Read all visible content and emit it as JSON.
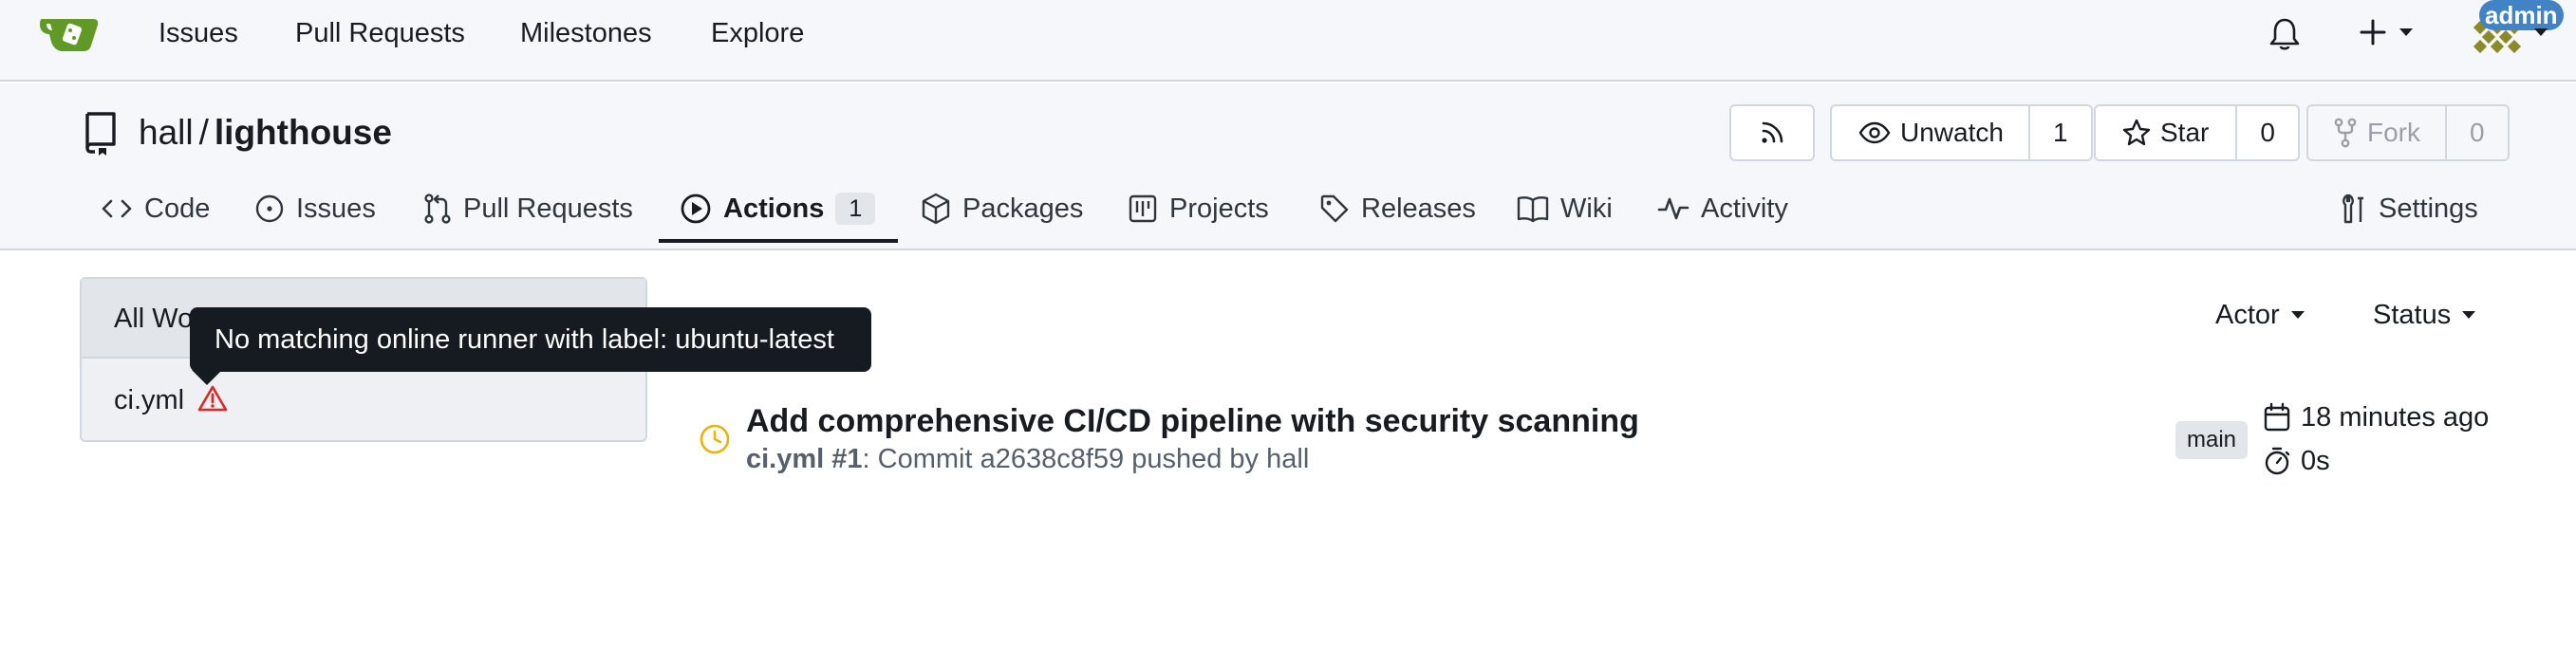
{
  "navbar": {
    "links": [
      "Issues",
      "Pull Requests",
      "Milestones",
      "Explore"
    ],
    "admin_badge": "admin"
  },
  "repo": {
    "owner": "hall",
    "separator": "/",
    "name": "lighthouse",
    "unwatch_label": "Unwatch",
    "watch_count": "1",
    "star_label": "Star",
    "star_count": "0",
    "fork_label": "Fork",
    "fork_count": "0"
  },
  "tabs": {
    "code": "Code",
    "issues": "Issues",
    "pull_requests": "Pull Requests",
    "actions": "Actions",
    "actions_count": "1",
    "packages": "Packages",
    "projects": "Projects",
    "releases": "Releases",
    "wiki": "Wiki",
    "activity": "Activity",
    "settings": "Settings"
  },
  "sidebar": {
    "items": [
      {
        "label": "All Workflows"
      },
      {
        "label": "ci.yml"
      }
    ]
  },
  "tooltip": {
    "text": "No matching online runner with label: ubuntu-latest"
  },
  "filters": {
    "actor": "Actor",
    "status": "Status"
  },
  "run": {
    "title": "Add comprehensive CI/CD pipeline with security scanning",
    "workflow": "ci.yml #1",
    "meta": ": Commit a2638c8f59 pushed by hall",
    "branch": "main",
    "time_ago": "18 minutes ago",
    "duration": "0s"
  },
  "colors": {
    "accent": "#4183c4",
    "warning": "#db2828",
    "waiting": "#eab308"
  }
}
